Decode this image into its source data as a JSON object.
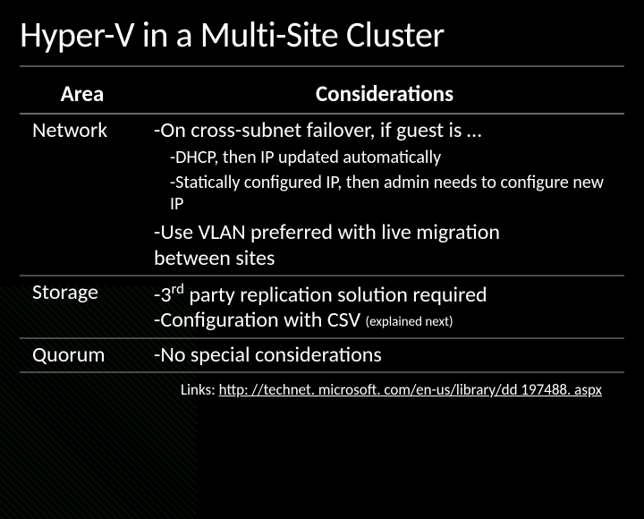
{
  "title": "Hyper-V in a Multi-Site Cluster",
  "columns": {
    "area": "Area",
    "considerations": "Considerations"
  },
  "network": {
    "area": "Network",
    "line1": "-On cross-subnet failover, if guest is …",
    "sub1": "-DHCP, then IP updated automatically",
    "sub2": "-Statically configured IP, then admin needs to configure new IP",
    "line2a": "-Use VLAN preferred with live migration",
    "line2b": "between sites"
  },
  "storage": {
    "area": "Storage",
    "line1_pre": "-3",
    "line1_sup": "rd",
    "line1_post": " party replication solution required",
    "line2_pre": "-Configuration with CSV ",
    "line2_note": "(explained next)"
  },
  "quorum": {
    "area": "Quorum",
    "line1": "-No special considerations"
  },
  "links": {
    "label": "Links: ",
    "url_text": "http: //technet. microsoft. com/en-us/library/dd 197488. aspx"
  }
}
